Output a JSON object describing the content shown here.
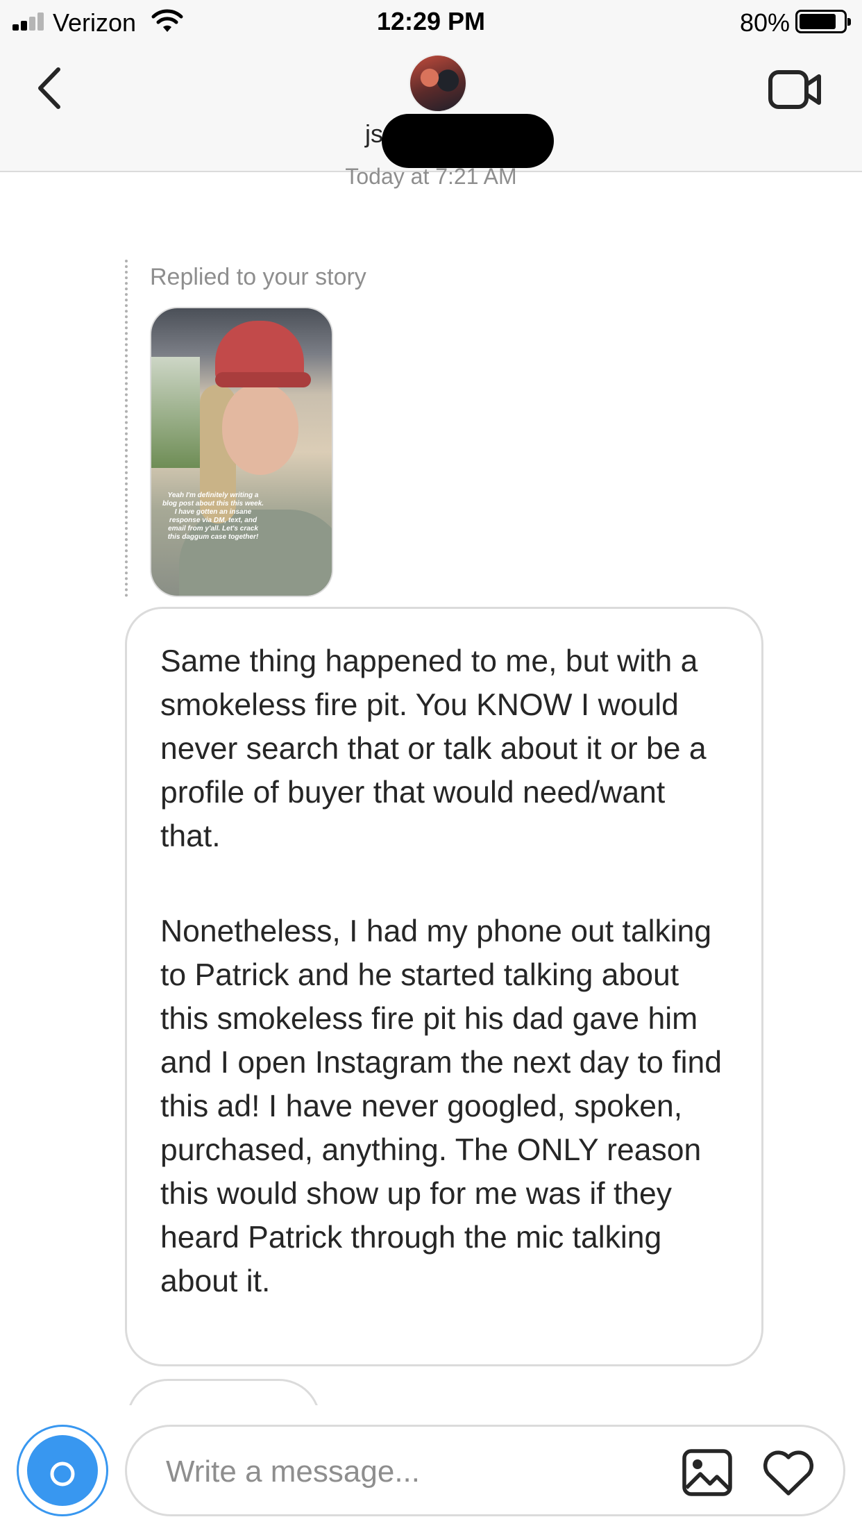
{
  "status_bar": {
    "carrier": "Verizon",
    "time": "12:29 PM",
    "battery_percent": "80%",
    "battery_level": 0.8,
    "signal_bars_active": 2,
    "signal_bars_total": 4
  },
  "header": {
    "back_icon": "chevron-left-icon",
    "username": "js",
    "username_redacted": true,
    "video_icon": "video-camera-icon"
  },
  "chat": {
    "timestamp": "Today at 7:21 AM",
    "story_reply_label": "Replied to your story",
    "story_caption": "Yeah I'm definitely writing a blog post about this this week. I have gotten an insane response via DM, text, and email from y'all. Let's crack this daggum case together!",
    "message_paragraphs": [
      "Same thing happened to me, but with a smokeless fire pit. You KNOW I would never search that or talk about it or be a profile of buyer that would need/want that.",
      "Nonetheless, I had my phone out talking to Patrick and he started talking about this smokeless fire pit his dad gave him and I open Instagram the next day to find this ad! I have never googled, spoken, purchased, anything. The ONLY reason this would show up for me was if they heard Patrick through the mic talking about it."
    ]
  },
  "composer": {
    "camera_icon": "camera-icon",
    "placeholder": "Write a message...",
    "gallery_icon": "image-icon",
    "heart_icon": "heart-icon",
    "accent_color": "#3897f0"
  }
}
